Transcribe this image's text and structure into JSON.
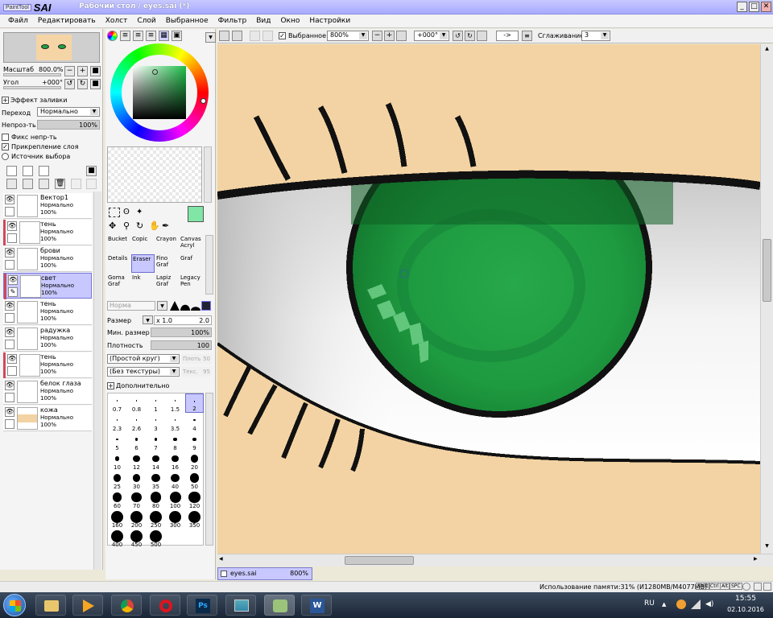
{
  "window": {
    "logo_small": "PaintTool",
    "logo_big": "SAI",
    "title": "Рабочий стол / eyes.sai (*)",
    "min_label": "_",
    "max_label": "□",
    "close_label": "✕"
  },
  "menu": [
    "Файл",
    "Редактировать",
    "Холст",
    "Слой",
    "Выбранное",
    "Фильтр",
    "Вид",
    "Окно",
    "Настройки"
  ],
  "navigator": {
    "zoom_label": "Масштаб",
    "zoom_value": "800.0%",
    "angle_label": "Угол",
    "angle_value": "+000°"
  },
  "layer_props": {
    "fill_effect": "Эффект заливки",
    "blend_label": "Переход",
    "blend_value": "Нормально",
    "opacity_label": "Непроз-ть",
    "opacity_value": "100%",
    "fix_opacity": "Фикс непр-ть",
    "clipping": "Прикрепление слоя",
    "selection_source": "Источник выбора"
  },
  "layers": [
    {
      "name": "Вектор1",
      "mode": "Нормально",
      "opacity": "100%",
      "marked": false,
      "selected": false
    },
    {
      "name": "тень",
      "mode": "Нормально",
      "opacity": "100%",
      "marked": true,
      "selected": false
    },
    {
      "name": "брови",
      "mode": "Нормально",
      "opacity": "100%",
      "marked": false,
      "selected": false
    },
    {
      "name": "свет",
      "mode": "Нормально",
      "opacity": "100%",
      "marked": true,
      "selected": true
    },
    {
      "name": "тень",
      "mode": "Нормально",
      "opacity": "100%",
      "marked": false,
      "selected": false
    },
    {
      "name": "радужка",
      "mode": "Нормально",
      "opacity": "100%",
      "marked": false,
      "selected": false
    },
    {
      "name": "тень",
      "mode": "Нормально",
      "opacity": "100%",
      "marked": true,
      "selected": false
    },
    {
      "name": "белок глаза",
      "mode": "Нормально",
      "opacity": "100%",
      "marked": false,
      "selected": false
    },
    {
      "name": "кожа",
      "mode": "Нормально",
      "opacity": "100%",
      "marked": false,
      "selected": false
    }
  ],
  "tools": [
    {
      "top": "Bucket",
      "bottom": ""
    },
    {
      "top": "Copic",
      "bottom": ""
    },
    {
      "top": "Crayon",
      "bottom": ""
    },
    {
      "top": "Canvas",
      "bottom": "Acryl"
    },
    {
      "top": "Details",
      "bottom": ""
    },
    {
      "top": "Eraser",
      "bottom": ""
    },
    {
      "top": "Fino",
      "bottom": "Graf"
    },
    {
      "top": "Graf",
      "bottom": ""
    },
    {
      "top": "Goma",
      "bottom": "Graf"
    },
    {
      "top": "Ink",
      "bottom": ""
    },
    {
      "top": "Lapiz",
      "bottom": "Graf"
    },
    {
      "top": "Legacy",
      "bottom": "Pen"
    }
  ],
  "brush": {
    "mode_value": "Норма",
    "size_label": "Размер",
    "size_mult": "x 1.0",
    "size_value": "2.0",
    "min_size_label": "Мин. размер",
    "min_size_value": "100%",
    "density_label": "Плотность",
    "density_value": "100",
    "shape_value": "(Простой круг)",
    "shape_num_label": "Плоть",
    "shape_num": "50",
    "texture_value": "(Без текстуры)",
    "texture_num_label": "Текс.",
    "texture_num": "95",
    "advanced": "Дополнительно"
  },
  "brush_sizes": [
    "0.7",
    "0.8",
    "1",
    "1.5",
    "2",
    "2.3",
    "2.6",
    "3",
    "3.5",
    "4",
    "5",
    "6",
    "7",
    "8",
    "9",
    "10",
    "12",
    "14",
    "16",
    "20",
    "25",
    "30",
    "35",
    "40",
    "50",
    "60",
    "70",
    "80",
    "100",
    "120",
    "160",
    "200",
    "250",
    "300",
    "350",
    "400",
    "450",
    "500"
  ],
  "canvas_toolbar": {
    "selection_label": "Выбранное",
    "zoom_value": "800%",
    "angle_value": "+000°",
    "arrow_label": "->",
    "smoothing_label": "Сглаживание",
    "smoothing_value": "3"
  },
  "file_tab": {
    "name": "eyes.sai",
    "zoom": "800%"
  },
  "status": {
    "memory": "Использование памяти:31% (И1280MB/M4077MB)",
    "keys": [
      "Shift",
      "Ctrl",
      "Alt",
      "SPC"
    ]
  },
  "taskbar": {
    "lang": "RU",
    "time": "15:55",
    "date": "02.10.2016"
  },
  "colors": {
    "skin": "#f3d3a3",
    "iris": "#1fa045",
    "iris_light": "#56c070",
    "primary_color": "#7fe6a6",
    "accent": "#c8c8ff"
  }
}
